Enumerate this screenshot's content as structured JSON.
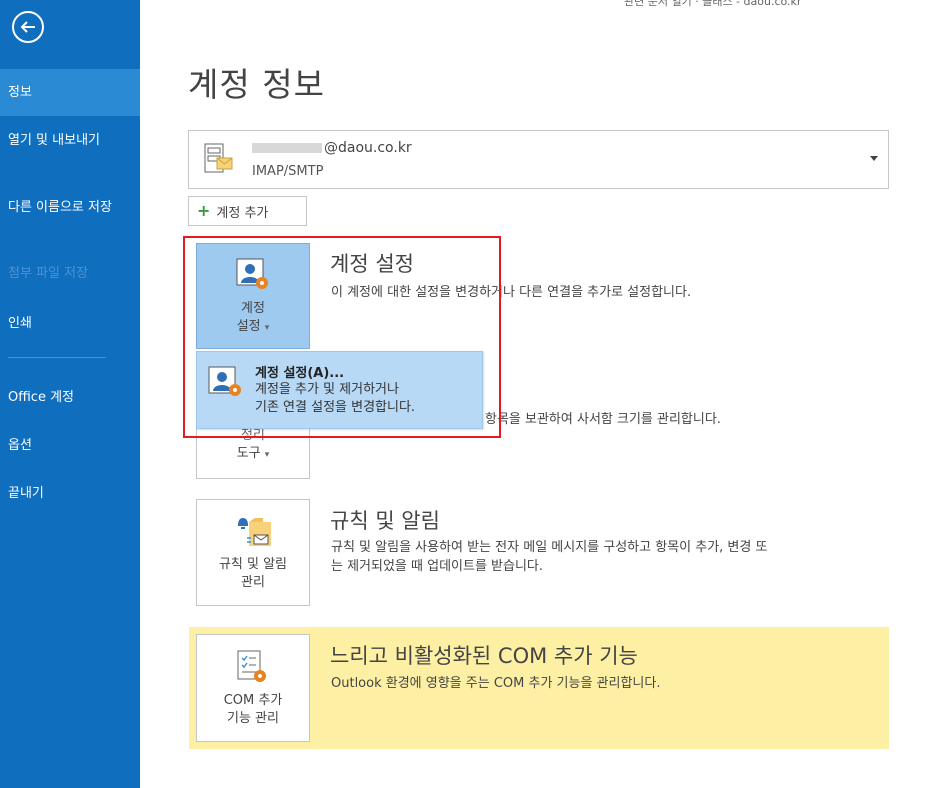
{
  "window": {
    "topright_text": "관련 문서 열기 · 클래스 - daou.co.kr"
  },
  "sidebar": {
    "items": [
      {
        "label": "정보"
      },
      {
        "label": "열기 및 내보내기"
      },
      {
        "label": "다른 이름으로 저장"
      },
      {
        "label": "첨부 파일 저장"
      },
      {
        "label": "인쇄"
      },
      {
        "label": "Office 계정"
      },
      {
        "label": "옵션"
      },
      {
        "label": "끝내기"
      }
    ]
  },
  "main": {
    "title": "계정 정보",
    "account": {
      "email_suffix": "@daou.co.kr",
      "type": "IMAP/SMTP"
    },
    "add_account_label": "계정 추가",
    "account_settings": {
      "tile_line1": "계정",
      "tile_line2": "설정",
      "title": "계정 설정",
      "description": "이 계정에 대한 설정을 변경하거나 다른 연결을 추가로 설정합니다."
    },
    "dropdown": {
      "title": "계정 설정(A)...",
      "desc_line1": "계정을 추가 및 제거하거나",
      "desc_line2": "기존 연결 설정을 변경합니다."
    },
    "cleanup": {
      "tile_line1": "정리",
      "tile_line2": "도구",
      "description_tail": "항목을 보관하여 사서함 크기를 관리합니다."
    },
    "rules": {
      "tile_line1": "규칙 및 알림",
      "tile_line2": "관리",
      "title": "규칙 및 알림",
      "desc_line1": "규칙 및 알림을 사용하여 받는 전자 메일 메시지를 구성하고 항목이 추가, 변경 또",
      "desc_line2": "는 제거되었을 때 업데이트를 받습니다."
    },
    "com": {
      "tile_line1": "COM 추가",
      "tile_line2": "기능 관리",
      "title": "느리고 비활성화된 COM 추가 기능",
      "description": "Outlook 환경에 영향을 주는 COM 추가 기능을 관리합니다."
    }
  },
  "colors": {
    "sidebar": "#106ebe",
    "sidebar_active": "#2a8ad4",
    "highlight_border": "#e21b23",
    "com_banner": "#fdf0a4",
    "dropdown_bg": "#b7d9f5"
  }
}
